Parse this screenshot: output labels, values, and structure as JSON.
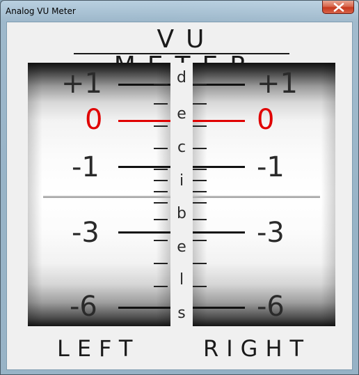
{
  "window": {
    "title": "Analog VU Meter",
    "close_icon": "close-icon"
  },
  "heading": "VU METER",
  "scale_marks": [
    "+1",
    "0",
    "-1",
    "-3",
    "-6"
  ],
  "center_letters": [
    "d",
    "e",
    "c",
    "i",
    "b",
    "e",
    "l",
    "s"
  ],
  "channels": {
    "left": {
      "label": "LEFT"
    },
    "right": {
      "label": "RIGHT"
    }
  },
  "colors": {
    "zero_mark": "#e00000",
    "close_button": "#c7381d"
  }
}
